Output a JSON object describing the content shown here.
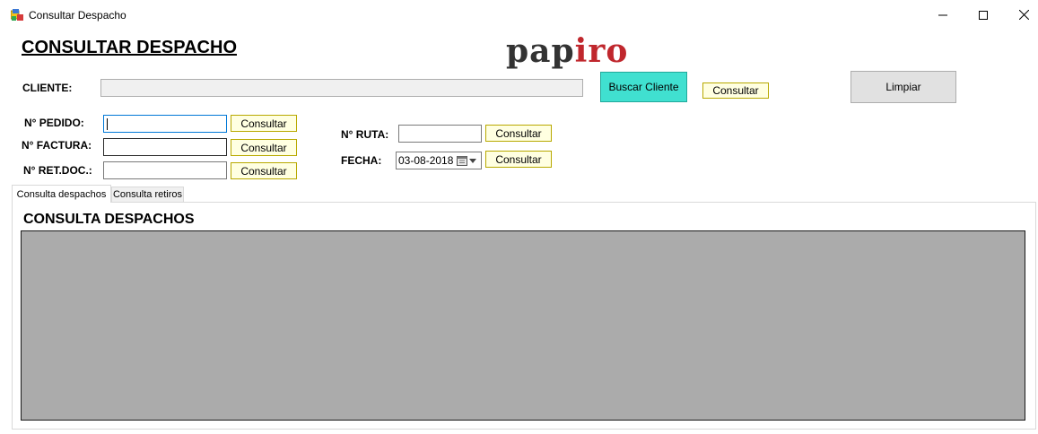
{
  "window": {
    "title": "Consultar Despacho",
    "controls": {
      "minimize": "—",
      "maximize": "☐",
      "close": "✕"
    }
  },
  "header": {
    "title": "CONSULTAR DESPACHO",
    "logo_part1": "pap",
    "logo_part2": "iro",
    "logo_color_dark": "#333333",
    "logo_color_accent": "#c0272d"
  },
  "cliente": {
    "label": "CLIENTE:",
    "value": "",
    "buscar_button": "Buscar Cliente",
    "consultar_button": "Consultar",
    "limpiar_button": "Limpiar"
  },
  "fields": {
    "pedido": {
      "label": "N° PEDIDO:",
      "value": "",
      "button": "Consultar"
    },
    "factura": {
      "label": "N° FACTURA:",
      "value": "",
      "button": "Consultar"
    },
    "retdoc": {
      "label": "N° RET.DOC.:",
      "value": "",
      "button": "Consultar"
    },
    "ruta": {
      "label": "N° RUTA:",
      "value": "",
      "button": "Consultar"
    },
    "fecha": {
      "label": "FECHA:",
      "value": "03-08-2018",
      "button": "Consultar"
    }
  },
  "tabs": [
    {
      "label": "Consulta despachos",
      "active": true
    },
    {
      "label": "Consulta retiros",
      "active": false
    }
  ],
  "panel": {
    "title": "CONSULTA DESPACHOS",
    "grid_color": "#ababab"
  },
  "colors": {
    "teal_button": "#40e0d0",
    "yellow_button": "#ffffe1",
    "focus_border": "#0078d7"
  }
}
